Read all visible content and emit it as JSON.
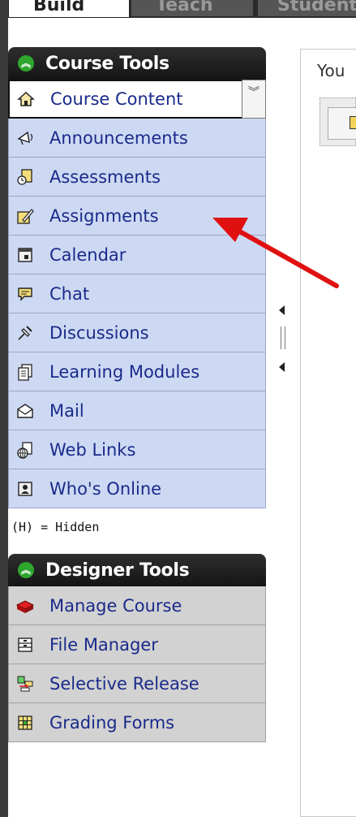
{
  "tabs": {
    "build": "Build",
    "teach": "Teach",
    "student": "Student"
  },
  "course_tools": {
    "title": "Course Tools",
    "items": [
      {
        "label": "Course Content",
        "icon": "house-icon"
      },
      {
        "label": "Announcements",
        "icon": "megaphone-icon"
      },
      {
        "label": "Assessments",
        "icon": "clipboard-timer-icon"
      },
      {
        "label": "Assignments",
        "icon": "pencil-pad-icon"
      },
      {
        "label": "Calendar",
        "icon": "calendar-icon"
      },
      {
        "label": "Chat",
        "icon": "speech-bubble-icon"
      },
      {
        "label": "Discussions",
        "icon": "pushpin-icon"
      },
      {
        "label": "Learning Modules",
        "icon": "pages-icon"
      },
      {
        "label": "Mail",
        "icon": "envelope-icon"
      },
      {
        "label": "Web Links",
        "icon": "globe-page-icon"
      },
      {
        "label": "Who's Online",
        "icon": "person-card-icon"
      }
    ],
    "hidden_note": "(H) = Hidden"
  },
  "designer_tools": {
    "title": "Designer Tools",
    "items": [
      {
        "label": "Manage Course",
        "icon": "red-blocks-icon"
      },
      {
        "label": "File Manager",
        "icon": "file-cabinet-icon"
      },
      {
        "label": "Selective Release",
        "icon": "release-flow-icon"
      },
      {
        "label": "Grading Forms",
        "icon": "grid-form-icon"
      }
    ]
  },
  "right_pane": {
    "text": "You"
  },
  "colors": {
    "course_item_bg": "#cdd9f3",
    "designer_item_bg": "#d2d2d2",
    "header_bg": "#151515",
    "toggle_green": "#2ea52e",
    "link_blue": "#1a2a8a",
    "arrow_red": "#e01010"
  }
}
